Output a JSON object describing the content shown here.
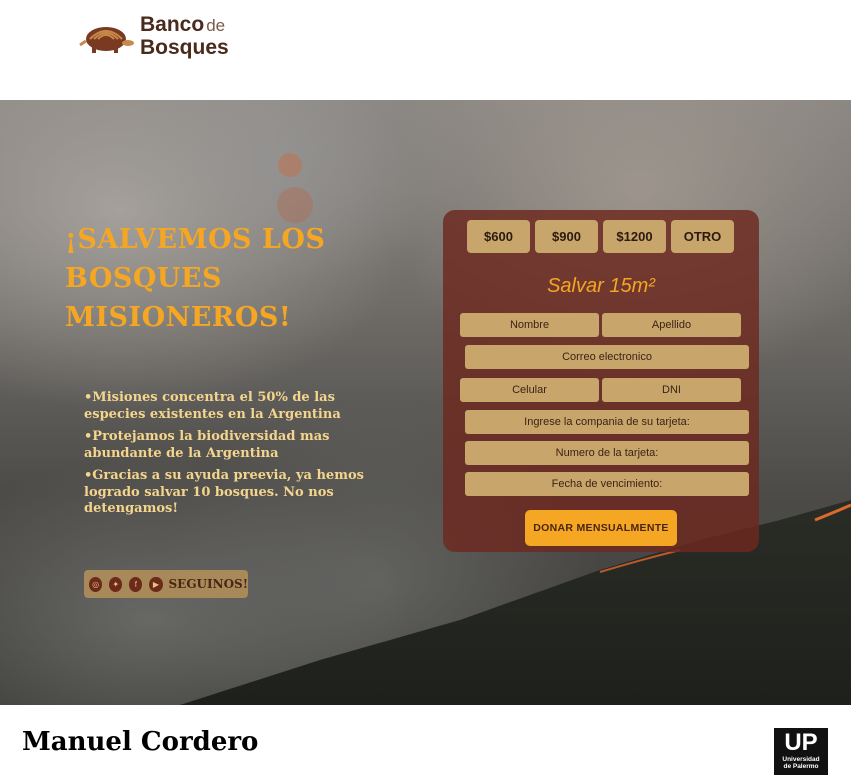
{
  "header": {
    "logo_word1": "Banco",
    "logo_de": "de",
    "logo_word2": "Bosques",
    "logo_icon": "armadillo-icon"
  },
  "hero": {
    "title": "¡SALVEMOS LOS BOSQUES MISIONEROS!",
    "bullets": [
      "•Misiones concentra el 50% de las especies existentes en la Argentina",
      "•Protejamos la biodiversidad mas abundante de la Argentina",
      "•Gracias a su ayuda preevia, ya hemos logrado salvar 10 bosques. No nos detengamos!"
    ],
    "social": {
      "icons": [
        "instagram-icon",
        "twitter-icon",
        "facebook-icon",
        "youtube-icon"
      ],
      "label": "SEGUINOS!"
    }
  },
  "form": {
    "amounts": [
      "$600",
      "$900",
      "$1200",
      "OTRO"
    ],
    "heading": "Salvar 15m²",
    "fields": {
      "nombre": "Nombre",
      "apellido": "Apellido",
      "correo": "Correo electronico",
      "celular": "Celular",
      "dni": "DNI",
      "compania": "Ingrese la compania de su tarjeta:",
      "numero": "Numero de la tarjeta:",
      "vencimiento": "Fecha de vencimiento:"
    },
    "submit": "DONAR MENSUALMENTE"
  },
  "footer": {
    "author": "Manuel Cordero",
    "up_logo_big": "UP",
    "up_logo_line1": "Universidad",
    "up_logo_line2": "de Palermo"
  },
  "colors": {
    "accent": "#f5a623",
    "panel": "#6c281e",
    "field": "#c8a56b",
    "bullet_text": "#f4d58d"
  }
}
